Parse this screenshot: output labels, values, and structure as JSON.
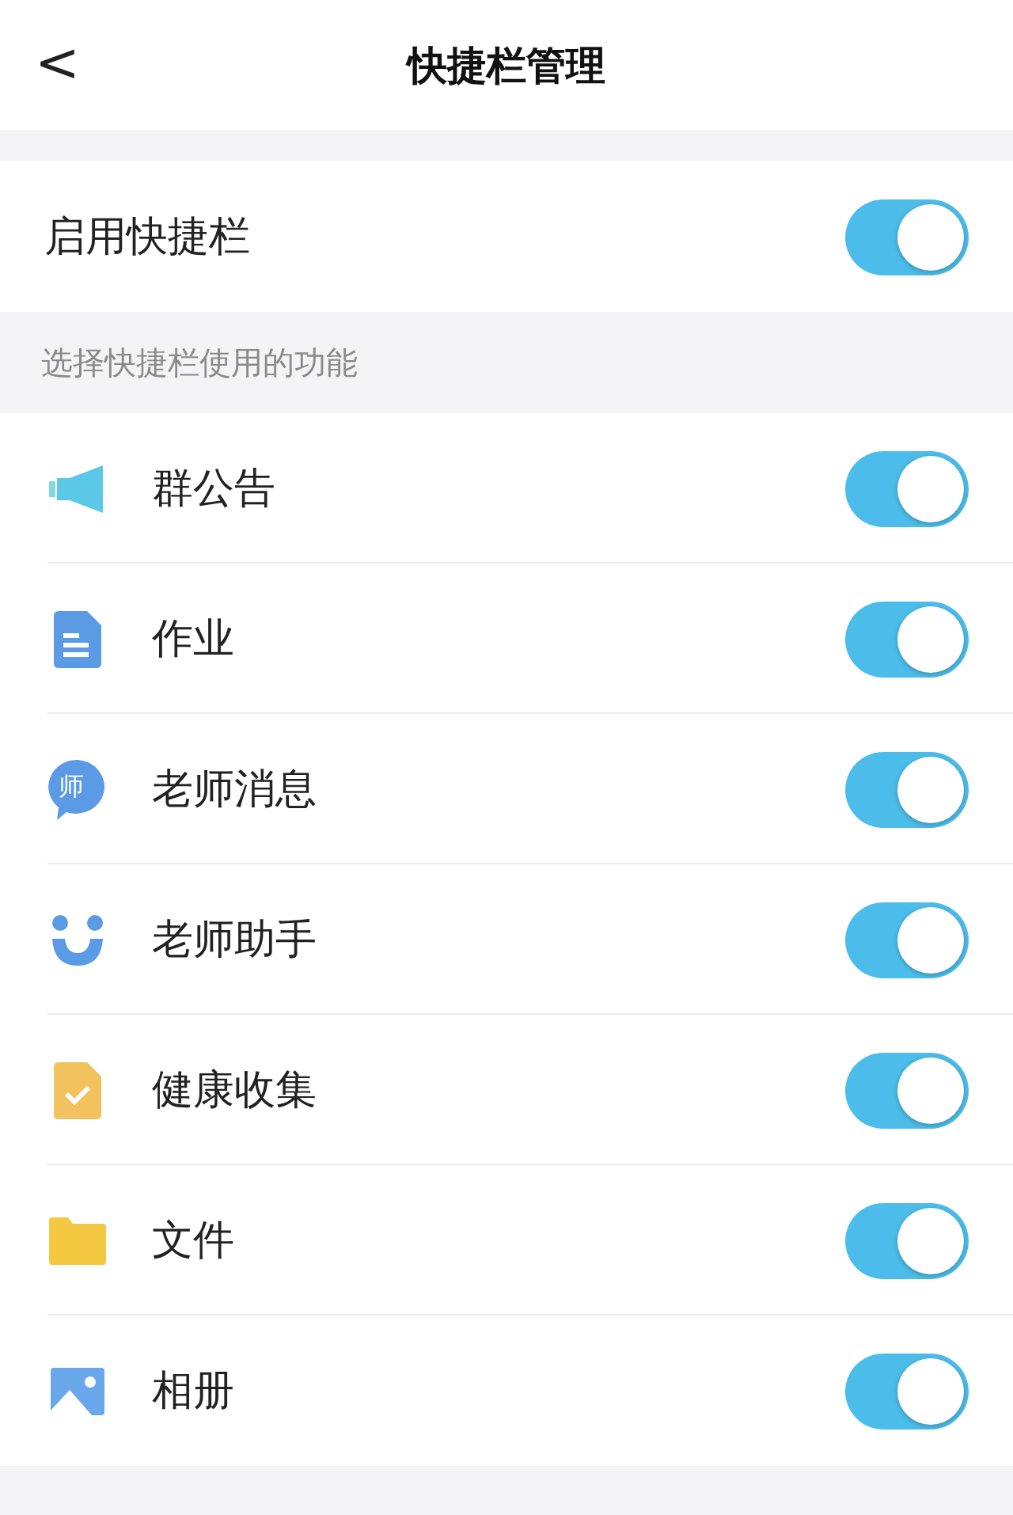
{
  "header": {
    "back": "<",
    "title": "快捷栏管理"
  },
  "enable": {
    "label": "启用快捷栏",
    "on": true
  },
  "section_label": "选择快捷栏使用的功能",
  "items": [
    {
      "kind": "megaphone",
      "label": "群公告",
      "on": true
    },
    {
      "kind": "document",
      "label": "作业",
      "on": true
    },
    {
      "kind": "bubble",
      "label": "老师消息",
      "on": true,
      "icon_text": "师"
    },
    {
      "kind": "smile",
      "label": "老师助手",
      "on": true
    },
    {
      "kind": "check",
      "label": "健康收集",
      "on": true
    },
    {
      "kind": "folder",
      "label": "文件",
      "on": true
    },
    {
      "kind": "photo",
      "label": "相册",
      "on": true
    }
  ]
}
